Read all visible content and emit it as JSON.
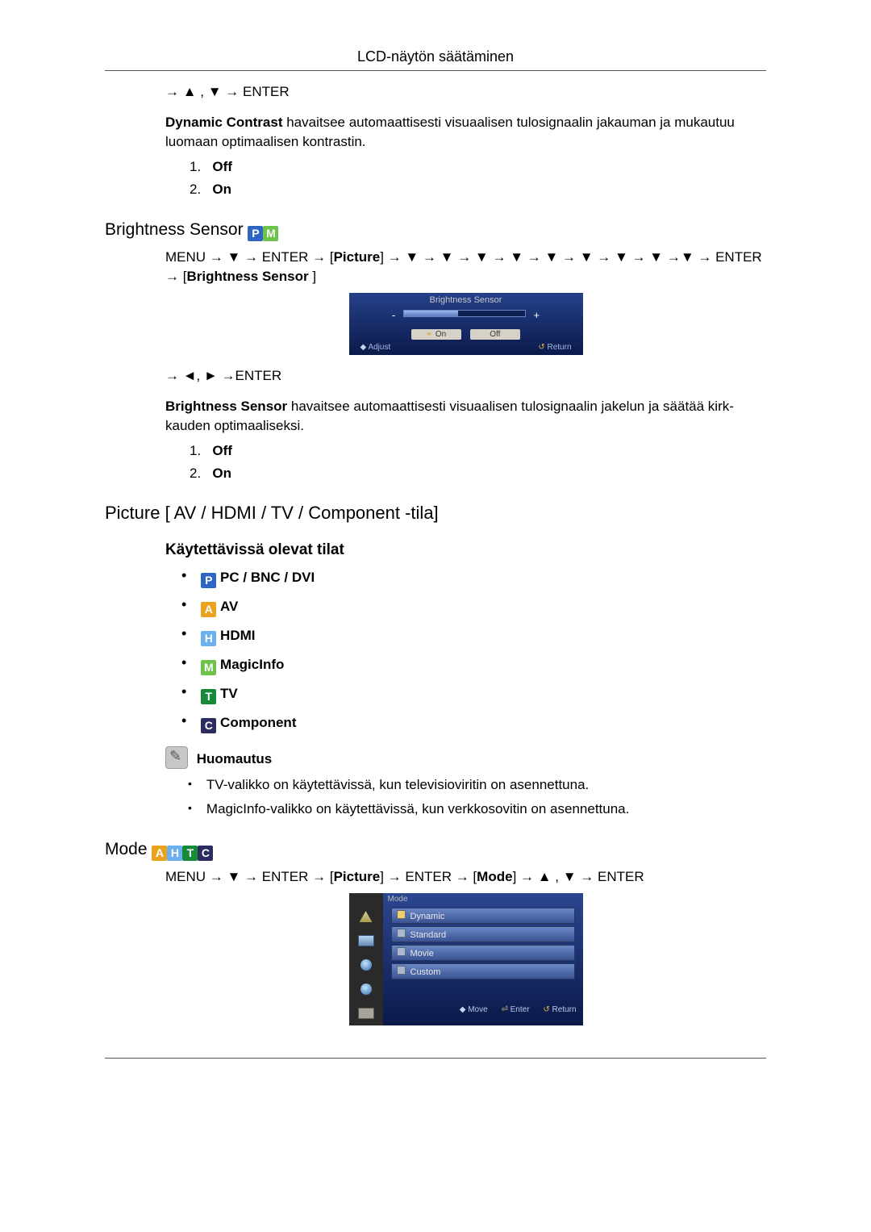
{
  "header": {
    "title": "LCD-näytön säätäminen"
  },
  "nav1": {
    "text": "→ ▲ , ▼ → ENTER"
  },
  "dynamic_contrast": {
    "bold": "Dynamic Contrast",
    "rest": " havaitsee automaattisesti visuaalisen tulosignaalin jakauman ja mukautuu luomaan optimaalisen kontrastin.",
    "items": [
      "Off",
      "On"
    ]
  },
  "brightness": {
    "title": "Brightness Sensor",
    "path": "MENU → ▼ → ENTER → [Picture] → ▼ → ▼ → ▼ → ▼ → ▼ → ▼ → ▼ → ▼ →▼ → ENTER → [Brightness Sensor ]",
    "osd": {
      "title": "Brightness Sensor",
      "minus": "-",
      "plus": "+",
      "on": "On",
      "off": "Off",
      "adjust": "Adjust",
      "return": "Return"
    },
    "nav": "→ ◄, ► →ENTER",
    "desc_bold": "Brightness Sensor",
    "desc_rest": " havaitsee automaattisesti visuaalisen tulosignaalin jakelun ja säätää kirk­kauden optimaaliseksi.",
    "items": [
      "Off",
      "On"
    ]
  },
  "picture": {
    "title": "Picture [ AV / HDMI / TV / Component -tila]",
    "sub": "Käytettävissä olevat tilat",
    "modes": {
      "pc": "PC / BNC / DVI",
      "av": "AV",
      "hdmi": "HDMI",
      "magic": "MagicInfo",
      "tv": "TV",
      "comp": "Component"
    },
    "note_label": "Huomautus",
    "notes": [
      "TV-valikko on käytettävissä, kun televisioviritin on asennettuna.",
      "MagicInfo-valikko on käytettävissä, kun verkkosovitin on asennettuna."
    ]
  },
  "mode": {
    "title": "Mode",
    "path": "MENU → ▼ → ENTER → [Picture] → ENTER → [Mode] → ▲ , ▼ → ENTER",
    "osd": {
      "head": "Mode",
      "opts": [
        "Dynamic",
        "Standard",
        "Movie",
        "Custom"
      ],
      "move": "Move",
      "enter": "Enter",
      "return": "Return"
    }
  }
}
